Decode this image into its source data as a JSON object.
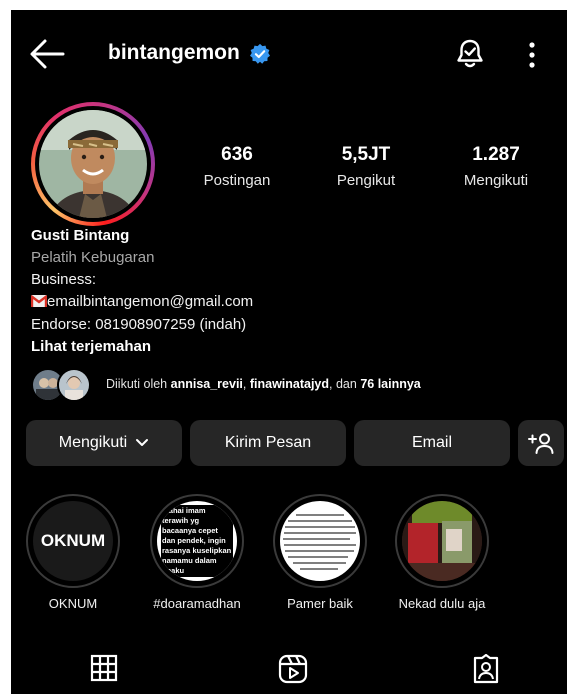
{
  "header": {
    "username": "bintangemon",
    "verified_icon": "verified-badge-icon",
    "back_icon": "arrow-left-icon",
    "notification_icon": "bell-check-icon",
    "more_icon": "more-vertical-icon"
  },
  "stats": [
    {
      "value": "636",
      "label": "Postingan"
    },
    {
      "value": "5,5JT",
      "label": "Pengikut"
    },
    {
      "value": "1.287",
      "label": "Mengikuti"
    }
  ],
  "bio": {
    "name": "Gusti Bintang",
    "category": "Pelatih Kebugaran",
    "line1": "Business:",
    "email": "emailbintangemon@gmail.com",
    "endorse": "Endorse: 081908907259 (indah)",
    "translate": "Lihat terjemahan"
  },
  "followed_by": {
    "prefix": "Diikuti oleh ",
    "user1": "annisa_revii",
    "sep": ", ",
    "user2": "finawinatajyd",
    "mid": ", dan ",
    "count": "76 lainnya"
  },
  "actions": {
    "following": "Mengikuti",
    "message": "Kirim Pesan",
    "email": "Email",
    "add_user_icon": "add-person-icon"
  },
  "highlights": [
    {
      "label": "OKNUM",
      "cover_text": "OKNUM"
    },
    {
      "label": "#doaramadhan",
      "cover_text": "Wahai imam terawih yg bacaanya cepet dan pendek, ingin rasanya kuselipkan namamu dalam doaku"
    },
    {
      "label": "Pamer baik"
    },
    {
      "label": "Nekad dulu aja"
    }
  ],
  "tabs": [
    "grid-icon",
    "reels-icon",
    "tagged-icon"
  ],
  "colors": {
    "background": "#000000",
    "button": "#262626",
    "verified": "#3897f0",
    "secondary_text": "#a8a8a8"
  }
}
